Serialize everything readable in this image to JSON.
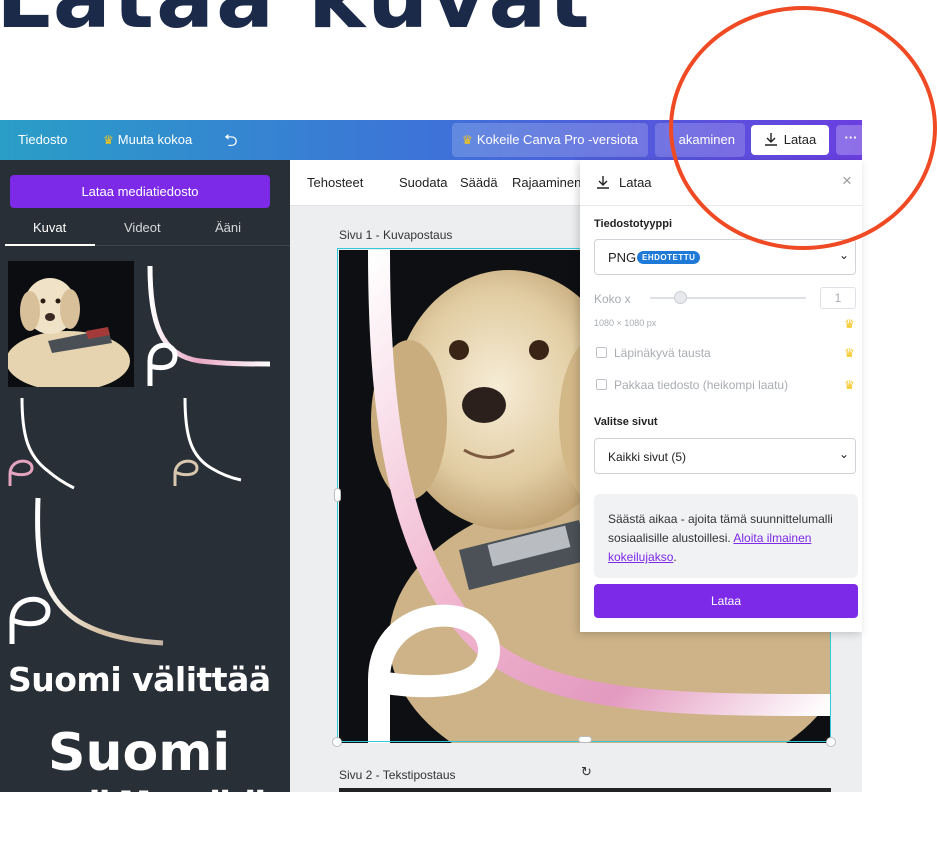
{
  "headline": "Lataa kuvat",
  "topbar": {
    "file": "Tiedosto",
    "resize": "Muuta kokoa",
    "pro_trial": "Kokeile Canva Pro -versiota",
    "share_partial": "akaminen",
    "download": "Lataa",
    "more": "···"
  },
  "sidebar": {
    "upload_button": "Lataa mediatiedosto",
    "tabs": [
      "Kuvat",
      "Videot",
      "Ääni"
    ],
    "text_asset_1": "Suomi välittää",
    "text_asset_2": "Suomi",
    "text_asset_2b": "välittää"
  },
  "context_toolbar": [
    "Tehosteet",
    "Suodata",
    "Säädä",
    "Rajaaminen"
  ],
  "canvas": {
    "page1_label": "Sivu 1 - Kuvapostaus",
    "page2_label": "Sivu 2 - Tekstipostaus"
  },
  "download_panel": {
    "title": "Lataa",
    "file_type_label": "Tiedostotyyppi",
    "file_type_value": "PNG",
    "suggested_badge": "EHDOTETTU",
    "size_label": "Koko x",
    "size_value": "1",
    "size_px": "1080 × 1080 px",
    "transparent_bg": "Läpinäkyvä tausta",
    "compress": "Pakkaa tiedosto (heikompi laatu)",
    "pages_label": "Valitse sivut",
    "pages_value": "Kaikki sivut (5)",
    "tip_text": "Säästä aikaa - ajoita tämä suunnittelumalli sosiaalisille alustoillesi. ",
    "tip_link": "Aloita ilmainen kokeilujakso",
    "tip_end": ".",
    "download_button": "Lataa"
  },
  "colors": {
    "accent": "#7d2ae8",
    "annotation": "#ef4a23",
    "selection": "#31c9d9"
  }
}
